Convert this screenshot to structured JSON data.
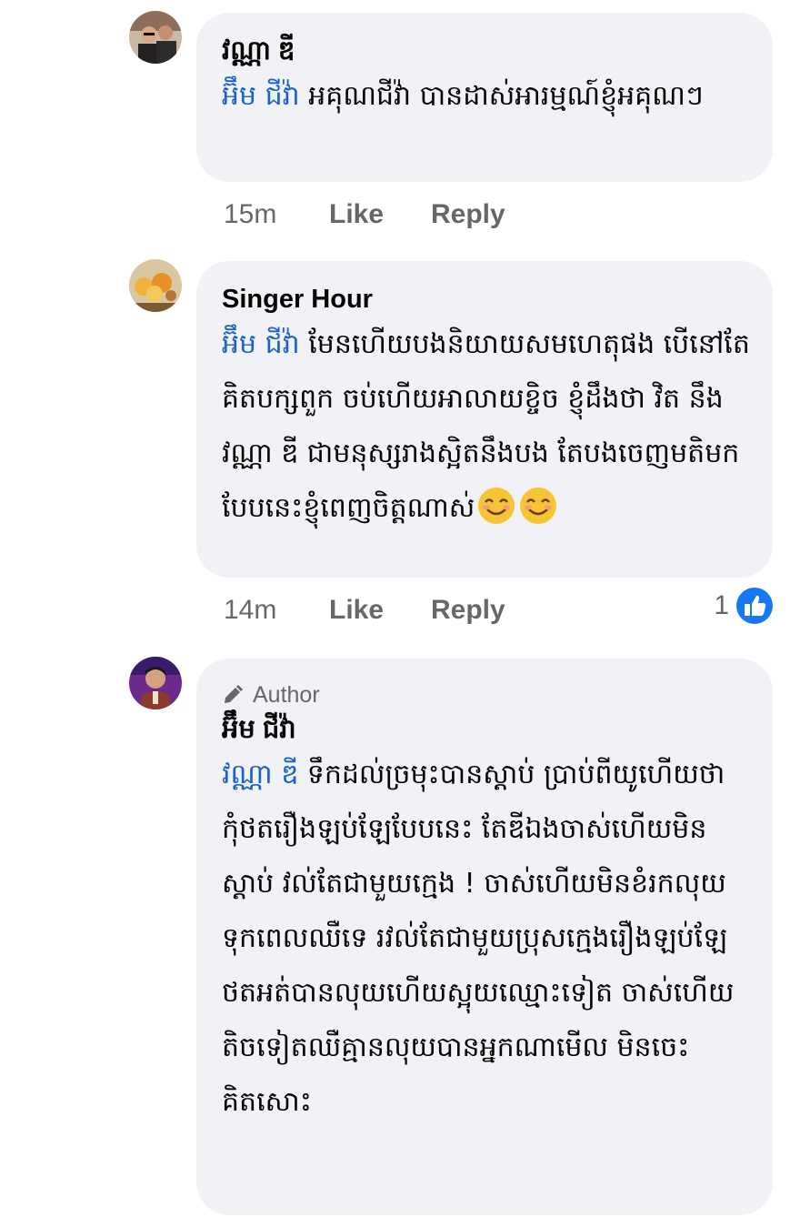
{
  "comments": [
    {
      "author": "វណ្ណា ឌី",
      "mention": "អ៊ឹម ជីវ៉ា",
      "text": " អគុណជីវ៉ា បានដាស់អារម្មណ៍ខ្ញុំអគុណៗ",
      "time": "15m",
      "like_label": "Like",
      "reply_label": "Reply"
    },
    {
      "author": "Singer Hour",
      "mention": "អ៊ឹម ជីវ៉ា",
      "text": " មែនហើយបងនិយាយសមហេតុផង បើនៅតែគិតបក្សពួក ចប់ហើយអាលាយខ្ចិច ខ្ញុំដឹងថា វិត នឹង វណ្ណា ឌី ជាមនុស្សរាងស្អិតនឹងបង តែបងចេញមតិមកបែបនេះខ្ញុំពេញចិត្តណាស់",
      "time": "14m",
      "like_label": "Like",
      "reply_label": "Reply",
      "reaction_count": "1"
    },
    {
      "badge": "Author",
      "author": "អ៊ឹម ជីវ៉ា",
      "mention": "វណ្ណា ឌី",
      "text": " ទឹកដល់ច្រមុះបានស្តាប់ ប្រាប់ពីយូហើយថាកុំថតរឿងឡប់ឡែបែបនេះ  តែឌីឯងចាស់ហើយមិនស្តាប់ វល់តែជាមួយក្មេង ! ចាស់ហើយមិនខំរកលុយទុកពេលឈឺទេ រវល់តែជាមួយប្រុសក្មេងរឿងឡប់ឡែ ថតអត់បានលុយហើយស្អុយឈ្មោះទៀត ចាស់ហើយតិចទៀតឈឺគ្មានលុយបានអ្នកណាមើល មិនចេះគិតសោះ"
    }
  ],
  "colors": {
    "bubble": "#f0f2f5",
    "mention": "#1b61c9",
    "meta": "#65676b",
    "like_blue": "#1877f2"
  },
  "icons": [
    "pencil-icon",
    "like-thumb-icon",
    "smiling-face-emoji"
  ]
}
